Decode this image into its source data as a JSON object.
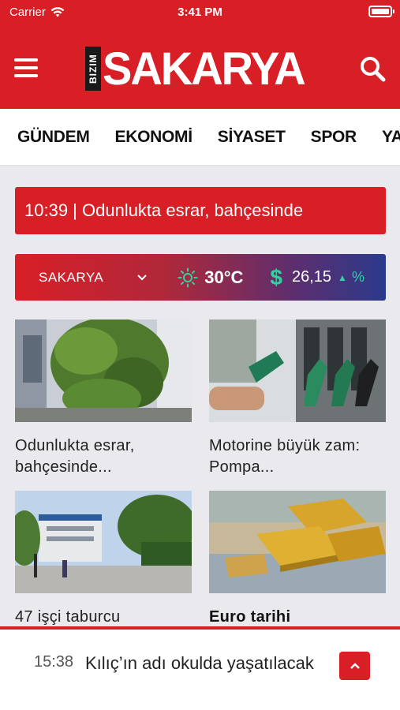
{
  "status_bar": {
    "carrier": "Carrier",
    "time": "3:41 PM"
  },
  "header": {
    "logo_small": "BIZIM",
    "logo_name": "SAKARYA"
  },
  "nav": {
    "tabs": [
      "GÜNDEM",
      "EKONOMİ",
      "SİYASET",
      "SPOR",
      "YAŞAM"
    ]
  },
  "ticker": {
    "text": "10:39 | Odunlukta esrar, bahçesinde"
  },
  "info_bar": {
    "city": "SAKARYA",
    "temperature": "30°C",
    "currency_symbol": "$",
    "rate": "26,15",
    "percent": "%"
  },
  "cards": [
    {
      "title": "Odunlukta esrar, bahçesinde..."
    },
    {
      "title": "Motorine büyük zam: Pompa..."
    },
    {
      "title": "47 işçi taburcu"
    },
    {
      "title": "Euro tarihi"
    }
  ],
  "bottom_bar": {
    "time": "15:38",
    "text": "Kılıç’ın adı okulda yaşatılacak"
  },
  "colors": {
    "brand_red": "#d81f26",
    "accent_green": "#2ed3a0"
  },
  "icons": [
    "wifi-icon",
    "battery-icon",
    "menu-icon",
    "search-icon",
    "chevron-down-icon",
    "sun-icon",
    "dollar-icon",
    "arrow-up-icon",
    "chevron-up-icon"
  ]
}
